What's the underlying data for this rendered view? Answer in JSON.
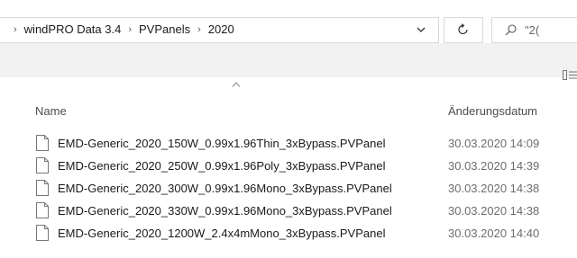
{
  "address_bar": {
    "breadcrumbs": [
      "windPRO Data 3.4",
      "PVPanels",
      "2020"
    ],
    "separator": "›"
  },
  "search": {
    "text": "\"2("
  },
  "columns": {
    "name": "Name",
    "date": "Änderungsdatum"
  },
  "files": [
    {
      "name": "EMD-Generic_2020_150W_0.99x1.96Thin_3xBypass.PVPanel",
      "date": "30.03.2020 14:09"
    },
    {
      "name": "EMD-Generic_2020_250W_0.99x1.96Poly_3xBypass.PVPanel",
      "date": "30.03.2020 14:39"
    },
    {
      "name": "EMD-Generic_2020_300W_0.99x1.96Mono_3xBypass.PVPanel",
      "date": "30.03.2020 14:38"
    },
    {
      "name": "EMD-Generic_2020_330W_0.99x1.96Mono_3xBypass.PVPanel",
      "date": "30.03.2020 14:38"
    },
    {
      "name": "EMD-Generic_2020_1200W_2.4x4mMono_3xBypass.PVPanel",
      "date": "30.03.2020 14:40"
    }
  ],
  "icons": {
    "dropdown": "chevron-down-icon",
    "refresh": "refresh-icon",
    "search": "search-icon",
    "view": "details-view-icon",
    "sort": "sort-up-icon",
    "file": "file-icon"
  }
}
